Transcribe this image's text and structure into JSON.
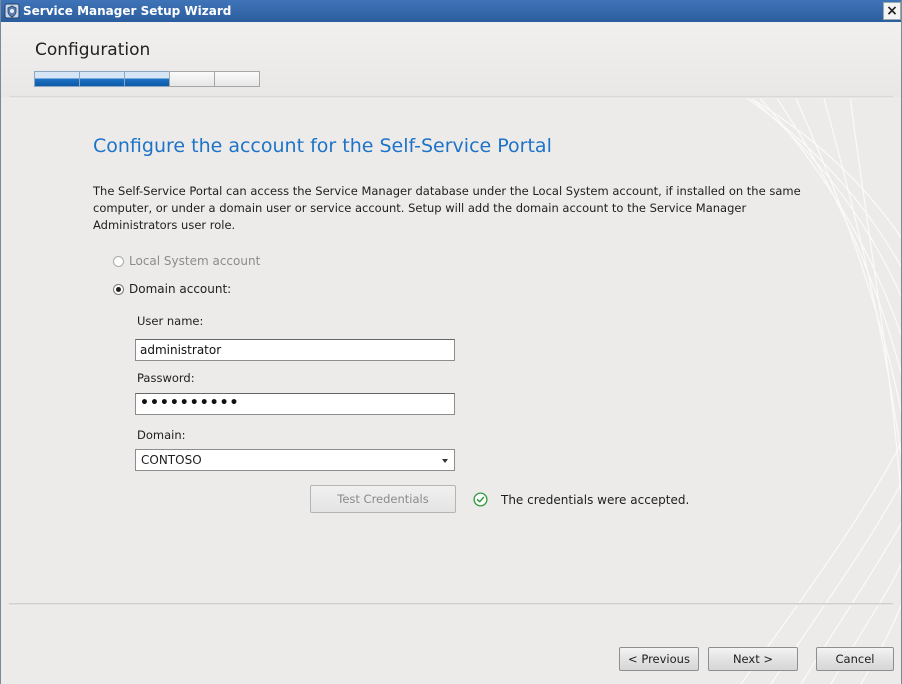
{
  "window": {
    "title": "Service Manager Setup Wizard",
    "close_glyph": "×"
  },
  "header": {
    "section_title": "Configuration",
    "progress": {
      "completed_steps": 3,
      "total_steps": 5
    }
  },
  "main": {
    "heading": "Configure the account for the Self-Service Portal",
    "description": "The Self-Service Portal can access the Service Manager database under the Local System account, if installed on the same computer, or under a domain user or service account. Setup will add the domain account to the Service Manager Administrators user role.",
    "account_options": {
      "local_system_label": "Local System account",
      "domain_account_label": "Domain account:",
      "selected": "Domain account:"
    },
    "username": {
      "label": "User name:",
      "value": "administrator"
    },
    "password": {
      "label": "Password:",
      "value": "••••••••••"
    },
    "domain": {
      "label": "Domain:",
      "value": "CONTOSO"
    },
    "test_button_label": "Test Credentials",
    "status_text": "The credentials were accepted."
  },
  "footer": {
    "previous_label": "< Previous",
    "next_label": "Next >",
    "cancel_label": "Cancel"
  },
  "icons": {
    "app": "setup-shield-icon",
    "status": "check-circle-icon",
    "dropdown": "chevron-down-icon"
  },
  "colors": {
    "title_bar": "#2b5e9e",
    "heading": "#1d73c8",
    "progress_fill": "#1e73c6",
    "success": "#2e9a3e"
  }
}
